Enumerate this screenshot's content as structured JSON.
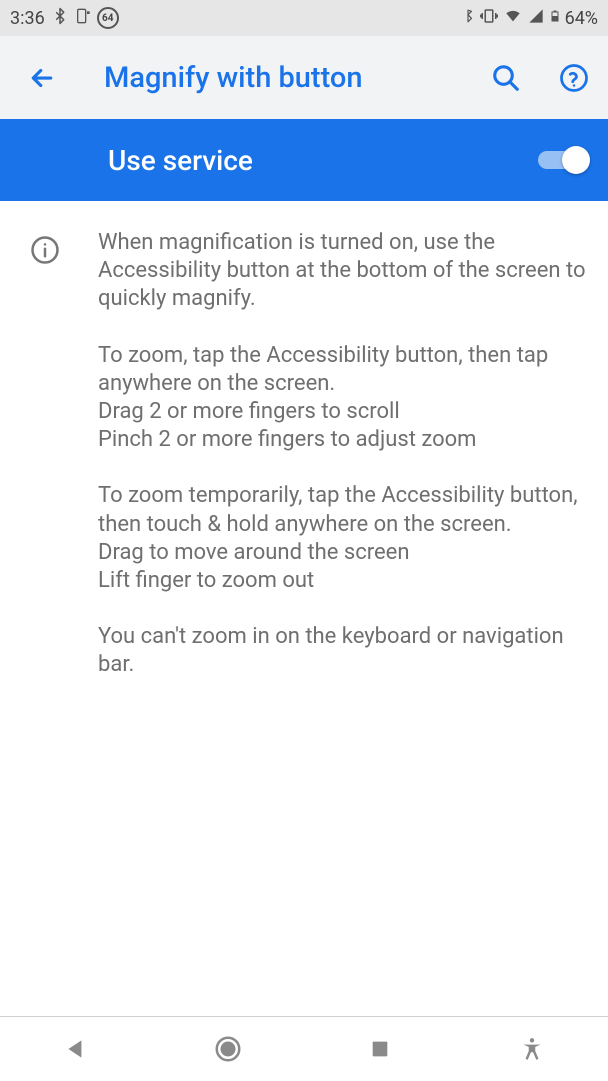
{
  "status_bar": {
    "time": "3:36",
    "badge": "64",
    "battery_text": "64%"
  },
  "app_bar": {
    "title": "Magnify with button"
  },
  "service_banner": {
    "label": "Use service",
    "enabled": true
  },
  "info_text": "When magnification is turned on, use the Accessibility button at the bottom of the screen to quickly magnify.\n\nTo zoom, tap the Accessibility button, then tap anywhere on the screen.\nDrag 2 or more fingers to scroll\nPinch 2 or more fingers to adjust zoom\n\nTo zoom temporarily, tap the Accessibility button, then touch & hold anywhere on the screen.\nDrag to move around the screen\nLift finger to zoom out\n\nYou can't zoom in on the keyboard or navigation bar."
}
